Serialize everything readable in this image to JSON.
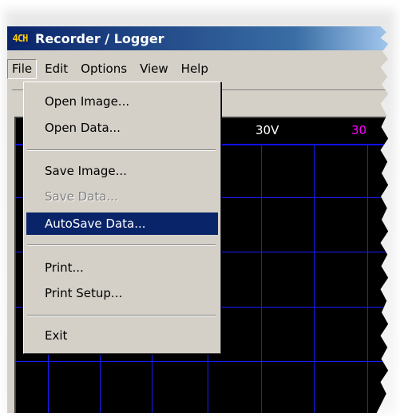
{
  "window": {
    "app_icon_text": "4CH",
    "title": "Recorder / Logger"
  },
  "menubar": {
    "items": [
      "File",
      "Edit",
      "Options",
      "View",
      "Help"
    ],
    "active": "File"
  },
  "scope": {
    "channel_labels": [
      "30V",
      "30"
    ],
    "colors": {
      "label1": "#ffffff",
      "label2": "#ff00ff",
      "grid": "#1a1aff",
      "background": "#000000"
    }
  },
  "file_menu": {
    "items": [
      {
        "label": "Open Image...",
        "state": "enabled"
      },
      {
        "label": "Open Data...",
        "state": "enabled"
      },
      {
        "label": "Save Image...",
        "state": "enabled"
      },
      {
        "label": "Save Data...",
        "state": "disabled"
      },
      {
        "label": "AutoSave Data...",
        "state": "selected"
      },
      {
        "label": "Print...",
        "state": "enabled"
      },
      {
        "label": "Print Setup...",
        "state": "enabled"
      },
      {
        "label": "Exit",
        "state": "enabled"
      }
    ],
    "highlight_color": "#0a246a"
  }
}
